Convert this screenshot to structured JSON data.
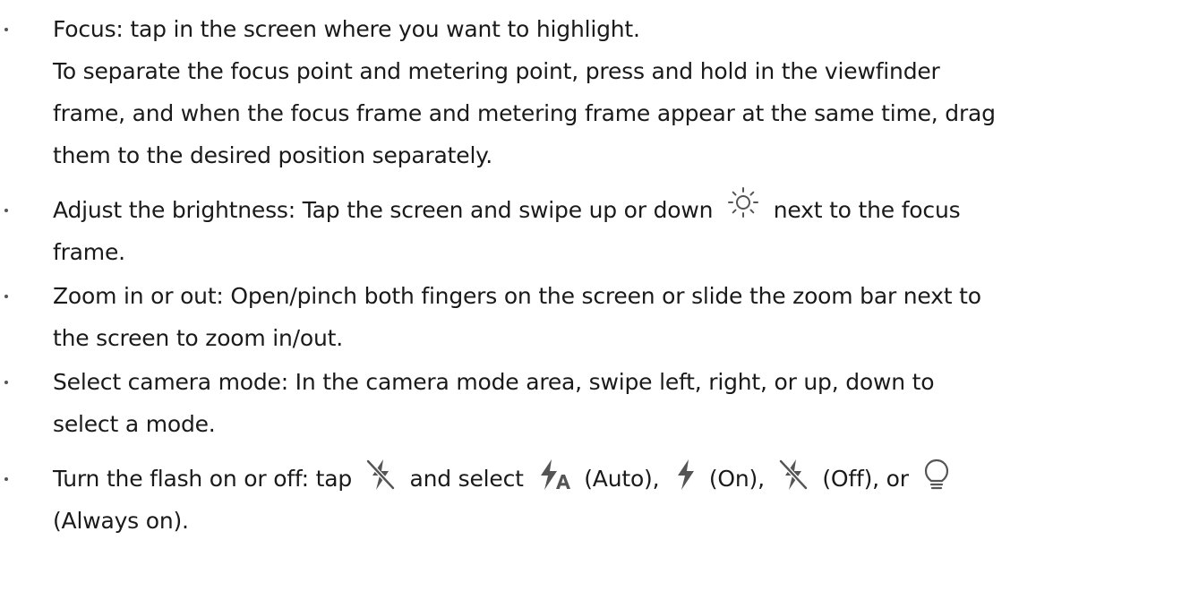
{
  "bullets": [
    {
      "lines": [
        "Focus: tap in the screen where you want to highlight.",
        "To separate the focus point and metering point, press and hold in the viewfinder",
        "frame, and when the focus frame and metering frame appear at the same time, drag",
        "them to the desired position separately."
      ]
    },
    {
      "before_icon": "Adjust the brightness: Tap the screen and swipe up or down",
      "icon": "sun-icon",
      "after_icon": "next to the focus",
      "line2": "frame."
    },
    {
      "lines": [
        "Zoom in or out: Open/pinch both fingers on the screen or slide the zoom bar next to",
        "the screen to zoom in/out."
      ]
    },
    {
      "lines": [
        "Select camera mode: In the camera mode area, swipe left, right, or up, down to",
        "select a mode."
      ]
    },
    {
      "text_tap": "Turn the flash on or off: tap",
      "text_select": "and select",
      "auto": "(Auto),",
      "on": "(On),",
      "off": "(Off), or",
      "always_on": "(Always on).",
      "icons": [
        "flash-off-icon",
        "flash-auto-icon",
        "flash-on-icon",
        "flash-off-icon",
        "bulb-icon"
      ],
      "icon_color": "#555555"
    }
  ]
}
